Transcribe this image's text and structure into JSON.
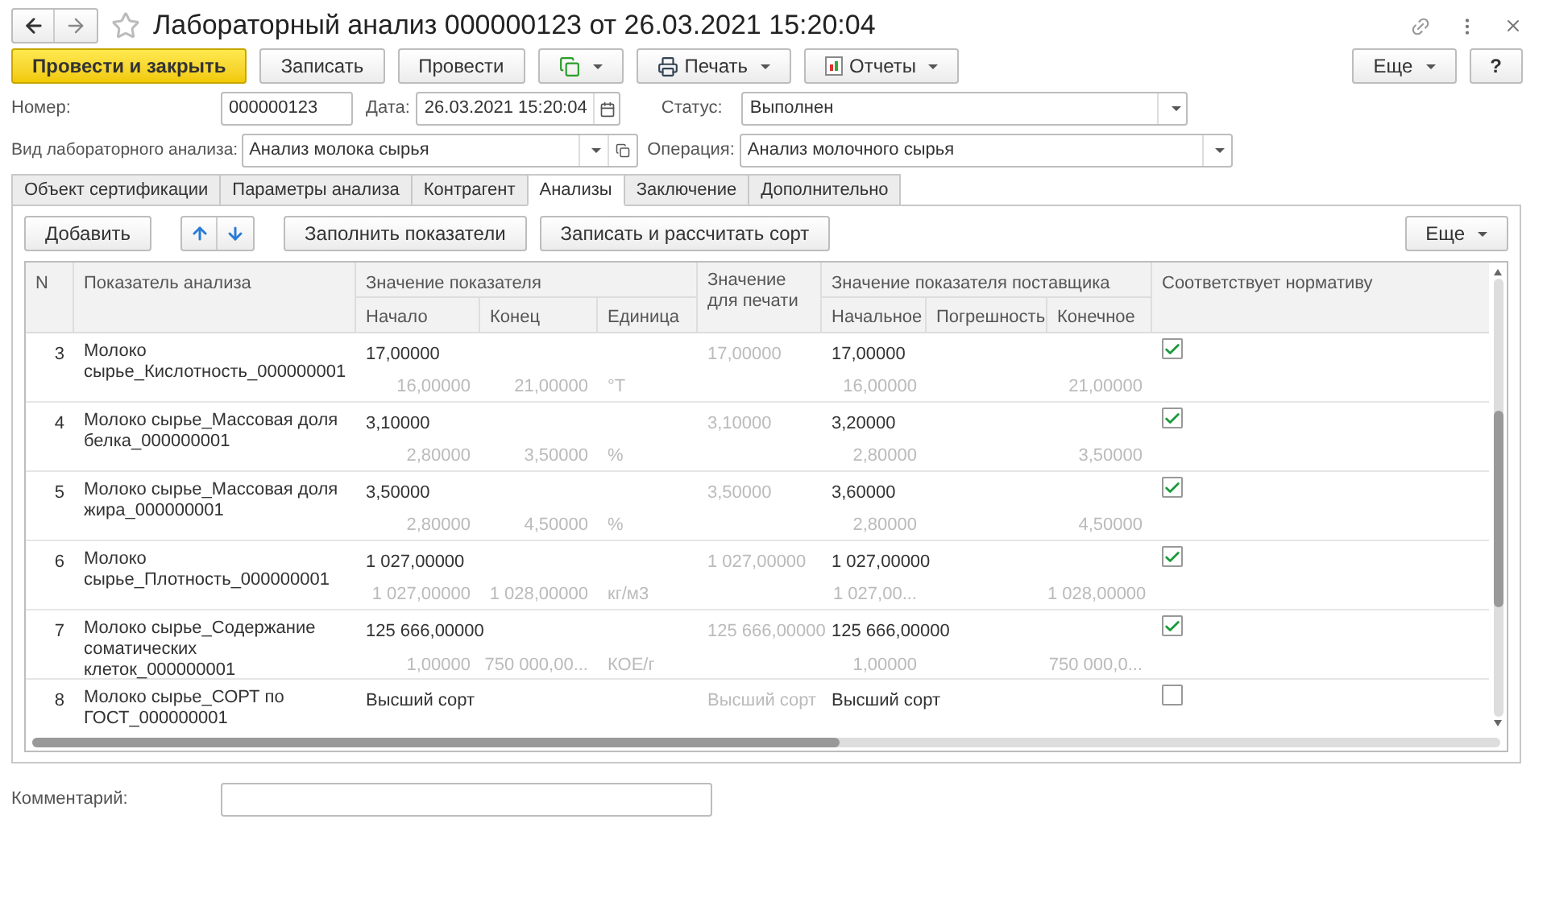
{
  "window": {
    "title": "Лабораторный анализ 000000123 от 26.03.2021 15:20:04",
    "favorite": false
  },
  "toolbar": {
    "primary": "Провести и закрыть",
    "buttons": [
      {
        "kind": "text",
        "label": "Записать"
      },
      {
        "kind": "text",
        "label": "Провести"
      },
      {
        "kind": "linked"
      },
      {
        "kind": "print",
        "label": "Печать"
      },
      {
        "kind": "report",
        "label": "Отчеты"
      }
    ],
    "more": "Еще",
    "help": "?"
  },
  "header": {
    "number_label": "Номер:",
    "number": "000000123",
    "date_label": "Дата:",
    "date": "26.03.2021 15:20:04",
    "status_label": "Статус:",
    "status": "Выполнен",
    "type_label": "Вид лабораторного анализа:",
    "type": "Анализ молока сырья",
    "operation_label": "Операция:",
    "operation": "Анализ молочного сырья"
  },
  "tabs": [
    {
      "label": "Объект сертификации",
      "selected": false
    },
    {
      "label": "Параметры анализа",
      "selected": false
    },
    {
      "label": "Контрагент",
      "selected": false
    },
    {
      "label": "Анализы",
      "selected": true
    },
    {
      "label": "Заключение",
      "selected": false
    },
    {
      "label": "Дополнительно",
      "selected": false
    }
  ],
  "table_toolbar": {
    "add": "Добавить",
    "fill": "Заполнить показатели",
    "save_calc": "Записать и рассчитать сорт",
    "more": "Еще"
  },
  "table": {
    "columns": {
      "n": "N",
      "indicator": "Показатель анализа",
      "value_group": "Значение показателя",
      "start": "Начало",
      "end": "Конец",
      "unit": "Единица",
      "print": "Значение для печати",
      "supplier_group": "Значение показателя поставщика",
      "supplier_start": "Начальное",
      "supplier_error": "Погрешность",
      "supplier_end": "Конечное",
      "conforms": "Соответствует нормативу"
    },
    "rows": [
      {
        "n": "3",
        "indicator": "Молоко сырье_Кислотность_000000001",
        "value": "17,00000",
        "min": "16,00000",
        "max": "21,00000",
        "unit": "°T",
        "print": "17,00000",
        "supplier": "17,00000",
        "supplier_min": "16,00000",
        "supplier_max": "21,00000",
        "checked": true
      },
      {
        "n": "4",
        "indicator": "Молоко сырье_Массовая доля белка_000000001",
        "value": "3,10000",
        "min": "2,80000",
        "max": "3,50000",
        "unit": "%",
        "print": "3,10000",
        "supplier": "3,20000",
        "supplier_min": "2,80000",
        "supplier_max": "3,50000",
        "checked": true
      },
      {
        "n": "5",
        "indicator": "Молоко сырье_Массовая доля жира_000000001",
        "value": "3,50000",
        "min": "2,80000",
        "max": "4,50000",
        "unit": "%",
        "print": "3,50000",
        "supplier": "3,60000",
        "supplier_min": "2,80000",
        "supplier_max": "4,50000",
        "checked": true
      },
      {
        "n": "6",
        "indicator": "Молоко сырье_Плотность_000000001",
        "value": "1 027,00000",
        "min": "1 027,00000",
        "max": "1 028,00000",
        "unit": "кг/м3",
        "print": "1 027,00000",
        "supplier": "1 027,00000",
        "supplier_min": "1 027,00...",
        "supplier_max": "1 028,00000",
        "checked": true
      },
      {
        "n": "7",
        "indicator": "Молоко сырье_Содержание соматических клеток_000000001",
        "value": "125 666,00000",
        "min": "1,00000",
        "max": "750 000,00...",
        "unit": "КОЕ/г",
        "print": "125 666,00000",
        "supplier": "125 666,00000",
        "supplier_min": "1,00000",
        "supplier_max": "750 000,0...",
        "checked": true
      },
      {
        "n": "8",
        "indicator": "Молоко сырье_СОРТ по ГОСТ_000000001",
        "value": "Высший сорт",
        "print": "Высший сорт",
        "supplier": "Высший сорт",
        "checked": false
      }
    ]
  },
  "comment": {
    "label": "Комментарий:"
  }
}
